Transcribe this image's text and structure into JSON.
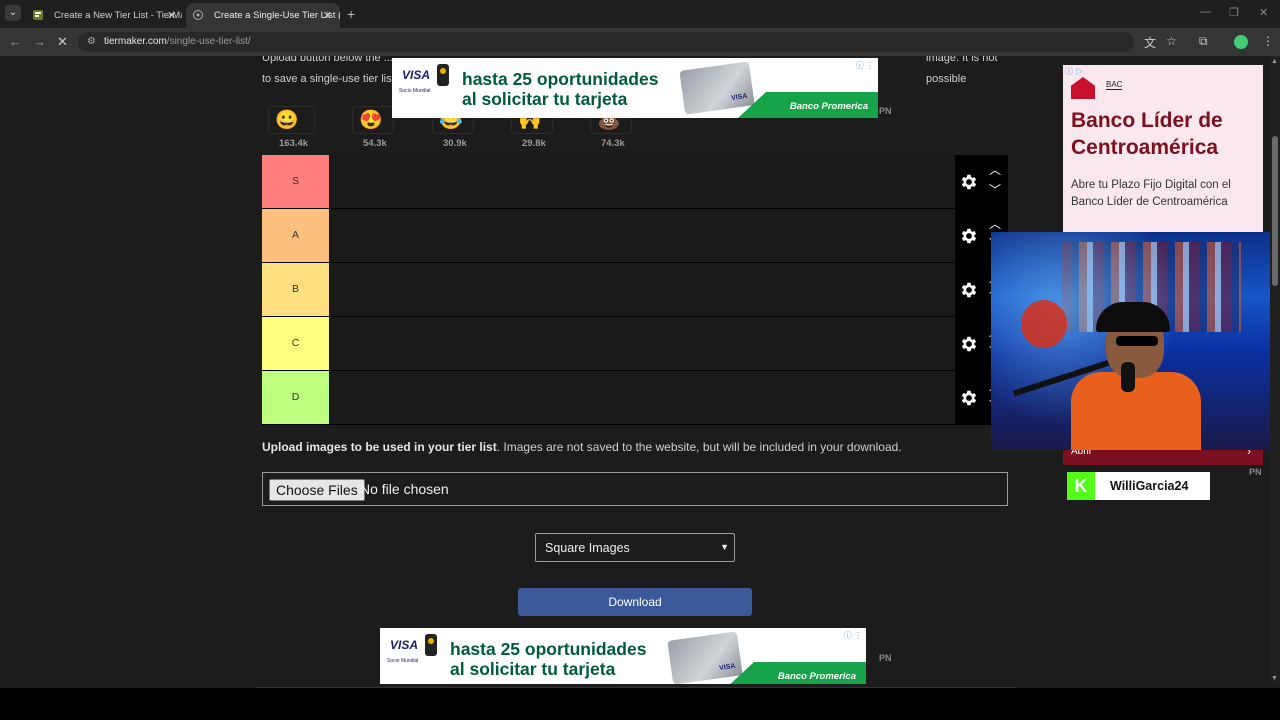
{
  "browser": {
    "tabs": [
      {
        "title": "Create a New Tier List - TierMaker",
        "active": false
      },
      {
        "title": "Create a Single-Use Tier List (Pi",
        "active": true
      }
    ],
    "url_host": "tiermaker.com",
    "url_path": "/single-use-tier-list/"
  },
  "intro": {
    "line1": "Upload button below the ...",
    "line2": "to save a single-use tier list ...",
    "line1_right": "image. It is not possible"
  },
  "reactions": [
    {
      "emoji": "😀",
      "count": "163.4k"
    },
    {
      "emoji": "😍",
      "count": "54.3k"
    },
    {
      "emoji": "😂",
      "count": "30.9k"
    },
    {
      "emoji": "🙌",
      "count": "29.8k"
    },
    {
      "emoji": "💩",
      "count": "74.3k"
    }
  ],
  "banner_ad": {
    "visa": "VISA",
    "visa_sub": "Socio Mundial",
    "headline_line1": "hasta 25 oportunidades",
    "headline_line2": "al solicitar tu tarjeta",
    "card_label": "VISA",
    "brand": "Banco Promerica",
    "pn": "PN"
  },
  "tiers": [
    {
      "label": "S",
      "color": "#ff7f7f"
    },
    {
      "label": "A",
      "color": "#ffbf7f"
    },
    {
      "label": "B",
      "color": "#ffdf7f"
    },
    {
      "label": "C",
      "color": "#ffff7f"
    },
    {
      "label": "D",
      "color": "#bfff7f"
    }
  ],
  "upload": {
    "desc_bold": "Upload images to be used in your tier list",
    "desc_rest": ". Images are not saved to the website, but will be included in your download.",
    "choose_files": "Choose Files",
    "no_file": "No file chosen"
  },
  "image_shape_select": {
    "value": "Square Images"
  },
  "download_label": "Download",
  "side_ad": {
    "brand": "BAC",
    "title": "Banco Líder de Centroamérica",
    "body": "Abre tu Plazo Fijo Digital con el Banco Líder de Centroamérica",
    "button_text": "Abrir",
    "pn": "PN"
  },
  "overlay": {
    "streamer_name": "WilliGarcia24"
  }
}
